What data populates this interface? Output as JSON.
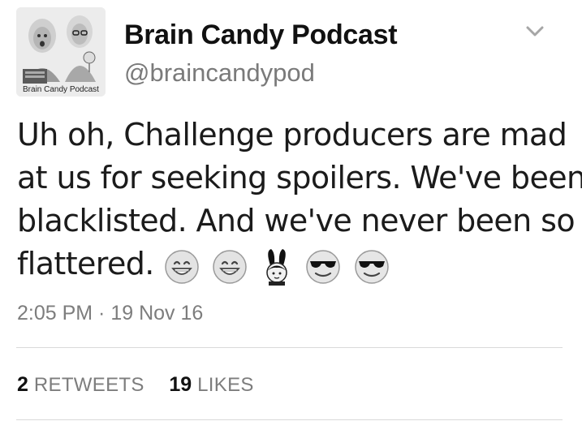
{
  "author": {
    "display_name": "Brain Candy Podcast",
    "handle": "@braincandypod",
    "avatar_caption": "Brain Candy Podcast"
  },
  "tweet": {
    "lines": [
      "Uh oh, Challenge producers are mad",
      "at us for seeking spoilers. We've been",
      "blacklisted. And we've never been so",
      "flattered."
    ],
    "emojis": [
      "grinning-face",
      "grinning-face",
      "woman-with-bunny-ears",
      "smiling-face-with-sunglasses",
      "smiling-face-with-sunglasses"
    ],
    "timestamp": "2:05 PM · 19 Nov 16"
  },
  "stats": {
    "retweets": {
      "count": "2",
      "label": "RETWEETS"
    },
    "likes": {
      "count": "19",
      "label": "LIKES"
    }
  },
  "icons": {
    "menu": "chevron-down-icon"
  },
  "colors": {
    "text": "#1b1b1b",
    "muted": "#7d7d7d",
    "divider": "#d9d9d9"
  }
}
